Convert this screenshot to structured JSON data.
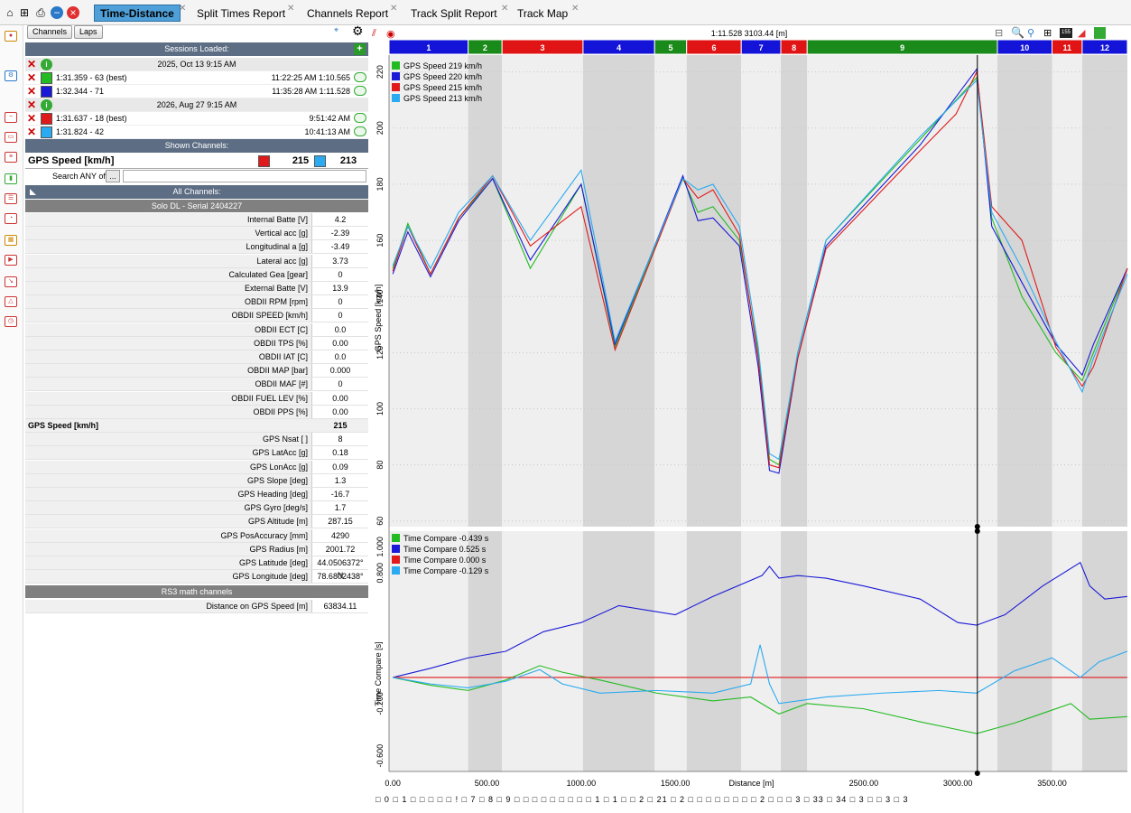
{
  "tabs": [
    {
      "label": "Time-Distance",
      "active": true
    },
    {
      "label": "Split Times Report"
    },
    {
      "label": "Channels Report"
    },
    {
      "label": "Track Split Report"
    },
    {
      "label": "Track Map"
    }
  ],
  "panel": {
    "channels_btn": "Channels",
    "laps_btn": "Laps",
    "sessions_loaded": "Sessions Loaded:",
    "sessions": [
      {
        "date": "2025, Oct 13 9:15 AM",
        "laps": [
          {
            "label": "1:31.359 - 63 (best)",
            "time": "11:22:25 AM 1:10.565",
            "color": "#22bb22"
          },
          {
            "label": "1:32.344 - 71",
            "time": "11:35:28 AM 1:11.528",
            "color": "#1a1ad6"
          }
        ]
      },
      {
        "date": "2026, Aug 27 9:15 AM",
        "laps": [
          {
            "label": "1:31.637 - 18 (best)",
            "time": "9:51:42 AM",
            "color": "#e01a1a"
          },
          {
            "label": "1:31.824 - 42",
            "time": "10:41:13 AM",
            "color": "#2aaaf0"
          }
        ]
      }
    ],
    "shown_channels": "Shown Channels:",
    "shown_channel": {
      "name": "GPS Speed [km/h]",
      "v1": "215",
      "v2": "213",
      "c1": "#e01a1a",
      "c2": "#2aaaf0"
    },
    "search_label": "Search ANY of",
    "all_channels": "All Channels:",
    "device": "Solo DL - Serial 2404227",
    "rows": [
      {
        "l": "Internal Batte [V]",
        "v": "4.2"
      },
      {
        "l": "Vertical acc [g]",
        "v": "-2.39"
      },
      {
        "l": "Longitudinal a [g]",
        "v": "-3.49"
      },
      {
        "l": "Lateral acc [g]",
        "v": "3.73"
      },
      {
        "l": "Calculated Gea [gear]",
        "v": "0"
      },
      {
        "l": "External Batte [V]",
        "v": "13.9"
      },
      {
        "l": "OBDII RPM [rpm]",
        "v": "0"
      },
      {
        "l": "OBDII SPEED [km/h]",
        "v": "0"
      },
      {
        "l": "OBDII ECT [C]",
        "v": "0.0"
      },
      {
        "l": "OBDII TPS [%]",
        "v": "0.00"
      },
      {
        "l": "OBDII IAT [C]",
        "v": "0.0"
      },
      {
        "l": "OBDII MAP [bar]",
        "v": "0.000"
      },
      {
        "l": "OBDII MAF [#]",
        "v": "0"
      },
      {
        "l": "OBDII FUEL LEV [%]",
        "v": "0.00"
      },
      {
        "l": "OBDII PPS [%]",
        "v": "0.00"
      },
      {
        "l": "GPS Speed [km/h]",
        "v": "215",
        "bold": true
      },
      {
        "l": "GPS Nsat [ ]",
        "v": "8"
      },
      {
        "l": "GPS LatAcc [g]",
        "v": "0.18"
      },
      {
        "l": "GPS LonAcc [g]",
        "v": "0.09"
      },
      {
        "l": "GPS Slope [deg]",
        "v": "1.3"
      },
      {
        "l": "GPS Heading [deg]",
        "v": "-16.7"
      },
      {
        "l": "GPS Gyro [deg/s]",
        "v": "1.7"
      },
      {
        "l": "GPS Altitude [m]",
        "v": "287.15"
      },
      {
        "l": "GPS PosAccuracy [mm]",
        "v": "4290"
      },
      {
        "l": "GPS Radius [m]",
        "v": "2001.72"
      },
      {
        "l": "GPS Latitude [deg]",
        "v": "44.0506372° N"
      },
      {
        "l": "GPS Longitude [deg]",
        "v": "78.6802438° W"
      }
    ],
    "math_header": "RS3 math channels",
    "math_rows": [
      {
        "l": "Distance on GPS Speed [m]",
        "v": "63834.11"
      }
    ]
  },
  "chart_header": "1:11.528 3103.44 [m]",
  "chart_data": [
    {
      "type": "line",
      "ylabel": "GPS Speed [km/h]",
      "xlabel": "Distance [m]",
      "xlim": [
        -20,
        3900
      ],
      "ylim": [
        58,
        226
      ],
      "yticks": [
        60,
        80,
        100,
        120,
        140,
        160,
        180,
        200,
        220
      ],
      "xticks": [
        0,
        500,
        1000,
        1500,
        2000,
        2500,
        3000,
        3500
      ],
      "xticklabels": [
        "0.00",
        "500.00",
        "1000.00",
        "1500.00",
        "",
        "2500.00",
        "3000.00",
        "3500.00"
      ],
      "cursor_x": 3103.44,
      "sectors": [
        {
          "label": "1",
          "start": -20,
          "end": 400,
          "color": "#1414d8"
        },
        {
          "label": "2",
          "start": 400,
          "end": 580,
          "color": "#1a8a1a"
        },
        {
          "label": "3",
          "start": 580,
          "end": 1010,
          "color": "#e01414"
        },
        {
          "label": "4",
          "start": 1010,
          "end": 1390,
          "color": "#1414d8"
        },
        {
          "label": "5",
          "start": 1390,
          "end": 1560,
          "color": "#1a8a1a"
        },
        {
          "label": "6",
          "start": 1560,
          "end": 1850,
          "color": "#e01414"
        },
        {
          "label": "7",
          "start": 1850,
          "end": 2060,
          "color": "#1414d8"
        },
        {
          "label": "8",
          "start": 2060,
          "end": 2200,
          "color": "#e01414"
        },
        {
          "label": "9",
          "start": 2200,
          "end": 3210,
          "color": "#1a8a1a"
        },
        {
          "label": "10",
          "start": 3210,
          "end": 3500,
          "color": "#1414d8"
        },
        {
          "label": "11",
          "start": 3500,
          "end": 3660,
          "color": "#e01414"
        },
        {
          "label": "12",
          "start": 3660,
          "end": 3900,
          "color": "#1414d8"
        }
      ],
      "series": [
        {
          "name": "GPS Speed",
          "value": "219",
          "unit": "km/h",
          "color": "#22bb22",
          "x": [
            0,
            80,
            200,
            350,
            530,
            730,
            1000,
            1180,
            1540,
            1620,
            1700,
            1840,
            1940,
            2000,
            2050,
            2150,
            2300,
            2800,
            3100,
            3180,
            3340,
            3520,
            3660,
            3720,
            3900
          ],
          "y": [
            150,
            166,
            148,
            168,
            182,
            150,
            180,
            122,
            182,
            170,
            172,
            160,
            120,
            82,
            80,
            120,
            160,
            196,
            218,
            168,
            140,
            120,
            110,
            120,
            150
          ]
        },
        {
          "name": "GPS Speed",
          "value": "220",
          "unit": "km/h",
          "color": "#1a1ad6",
          "x": [
            0,
            80,
            200,
            350,
            530,
            730,
            1000,
            1180,
            1540,
            1620,
            1700,
            1840,
            1940,
            2000,
            2050,
            2150,
            2300,
            2800,
            3100,
            3180,
            3340,
            3520,
            3660,
            3720,
            3900
          ],
          "y": [
            148,
            163,
            147,
            167,
            182,
            153,
            180,
            123,
            183,
            167,
            168,
            158,
            115,
            78,
            77,
            118,
            158,
            194,
            221,
            165,
            145,
            123,
            112,
            123,
            150
          ]
        },
        {
          "name": "GPS Speed",
          "value": "215",
          "unit": "km/h",
          "color": "#e01a1a",
          "x": [
            0,
            80,
            200,
            350,
            530,
            730,
            1000,
            1180,
            1540,
            1620,
            1700,
            1840,
            1940,
            2000,
            2050,
            2150,
            2300,
            2800,
            2990,
            3100,
            3180,
            3340,
            3520,
            3660,
            3720,
            3900
          ],
          "y": [
            149,
            165,
            148,
            168,
            183,
            158,
            172,
            121,
            182,
            175,
            178,
            162,
            118,
            80,
            79,
            118,
            157,
            192,
            205,
            220,
            172,
            160,
            122,
            108,
            115,
            150
          ]
        },
        {
          "name": "GPS Speed",
          "value": "213",
          "unit": "km/h",
          "color": "#2aaaf0",
          "x": [
            0,
            80,
            200,
            350,
            530,
            730,
            1000,
            1180,
            1540,
            1620,
            1700,
            1840,
            1940,
            2000,
            2050,
            2150,
            2300,
            2800,
            3100,
            3180,
            3340,
            3520,
            3660,
            3720,
            3900
          ],
          "y": [
            151,
            165,
            150,
            170,
            183,
            160,
            185,
            124,
            182,
            178,
            180,
            165,
            122,
            84,
            82,
            120,
            160,
            197,
            217,
            170,
            150,
            124,
            106,
            118,
            148
          ]
        }
      ]
    },
    {
      "type": "line",
      "ylabel": "Time Compare [s]",
      "xlabel": "Distance [m]",
      "xlim": [
        -20,
        3900
      ],
      "ylim": [
        -0.72,
        1.12
      ],
      "yticks": [
        -0.6,
        -0.2,
        0.8,
        1.0
      ],
      "yticklabels": [
        "-0.600",
        "-0.200",
        "0.800",
        "1.000"
      ],
      "series": [
        {
          "name": "Time Compare",
          "value": "-0.439",
          "unit": "s",
          "color": "#22bb22",
          "x": [
            0,
            200,
            400,
            600,
            780,
            900,
            1100,
            1400,
            1700,
            1900,
            2050,
            2200,
            2500,
            2800,
            3000,
            3100,
            3300,
            3500,
            3600,
            3700,
            3900
          ],
          "y": [
            0,
            -0.06,
            -0.1,
            -0.02,
            0.09,
            0.04,
            -0.02,
            -0.12,
            -0.18,
            -0.15,
            -0.28,
            -0.2,
            -0.24,
            -0.34,
            -0.4,
            -0.43,
            -0.35,
            -0.25,
            -0.2,
            -0.32,
            -0.3
          ]
        },
        {
          "name": "Time Compare",
          "value": "0.525",
          "unit": "s",
          "color": "#1a1ad6",
          "x": [
            0,
            200,
            400,
            600,
            800,
            1000,
            1200,
            1500,
            1700,
            1960,
            2000,
            2050,
            2150,
            2300,
            2500,
            2800,
            3000,
            3100,
            3250,
            3450,
            3650,
            3700,
            3780,
            3900
          ],
          "y": [
            0,
            0.07,
            0.15,
            0.2,
            0.35,
            0.42,
            0.55,
            0.48,
            0.62,
            0.78,
            0.85,
            0.76,
            0.78,
            0.76,
            0.7,
            0.6,
            0.42,
            0.4,
            0.48,
            0.7,
            0.88,
            0.7,
            0.6,
            0.62
          ]
        },
        {
          "name": "Time Compare",
          "value": "0.000",
          "unit": "s",
          "color": "#e01a1a",
          "x": [
            0,
            3900
          ],
          "y": [
            0,
            0
          ]
        },
        {
          "name": "Time Compare",
          "value": "-0.129",
          "unit": "s",
          "color": "#2aaaf0",
          "x": [
            0,
            200,
            400,
            600,
            780,
            900,
            1100,
            1400,
            1700,
            1900,
            1950,
            2000,
            2050,
            2300,
            2600,
            2900,
            3100,
            3300,
            3500,
            3600,
            3650,
            3750,
            3900
          ],
          "y": [
            0,
            -0.05,
            -0.08,
            -0.03,
            0.06,
            -0.05,
            -0.12,
            -0.1,
            -0.12,
            -0.05,
            0.25,
            -0.05,
            -0.2,
            -0.15,
            -0.12,
            -0.1,
            -0.12,
            0.05,
            0.15,
            0.05,
            0.0,
            0.12,
            0.2
          ]
        }
      ]
    }
  ],
  "bottom_markers": "□ 0 □ 1 □ □ □ □ □ ! □ 7 □ 8 □ 9 □ □ □ □ □ □ □ □ □ 1 □ 1 □ □ 2 □ 21 □ 2 □ □ □ □ □ □ □ □ 2 □ □ □ 3 □ 33 □ 34 □ 3 □ □ 3 □ 3"
}
